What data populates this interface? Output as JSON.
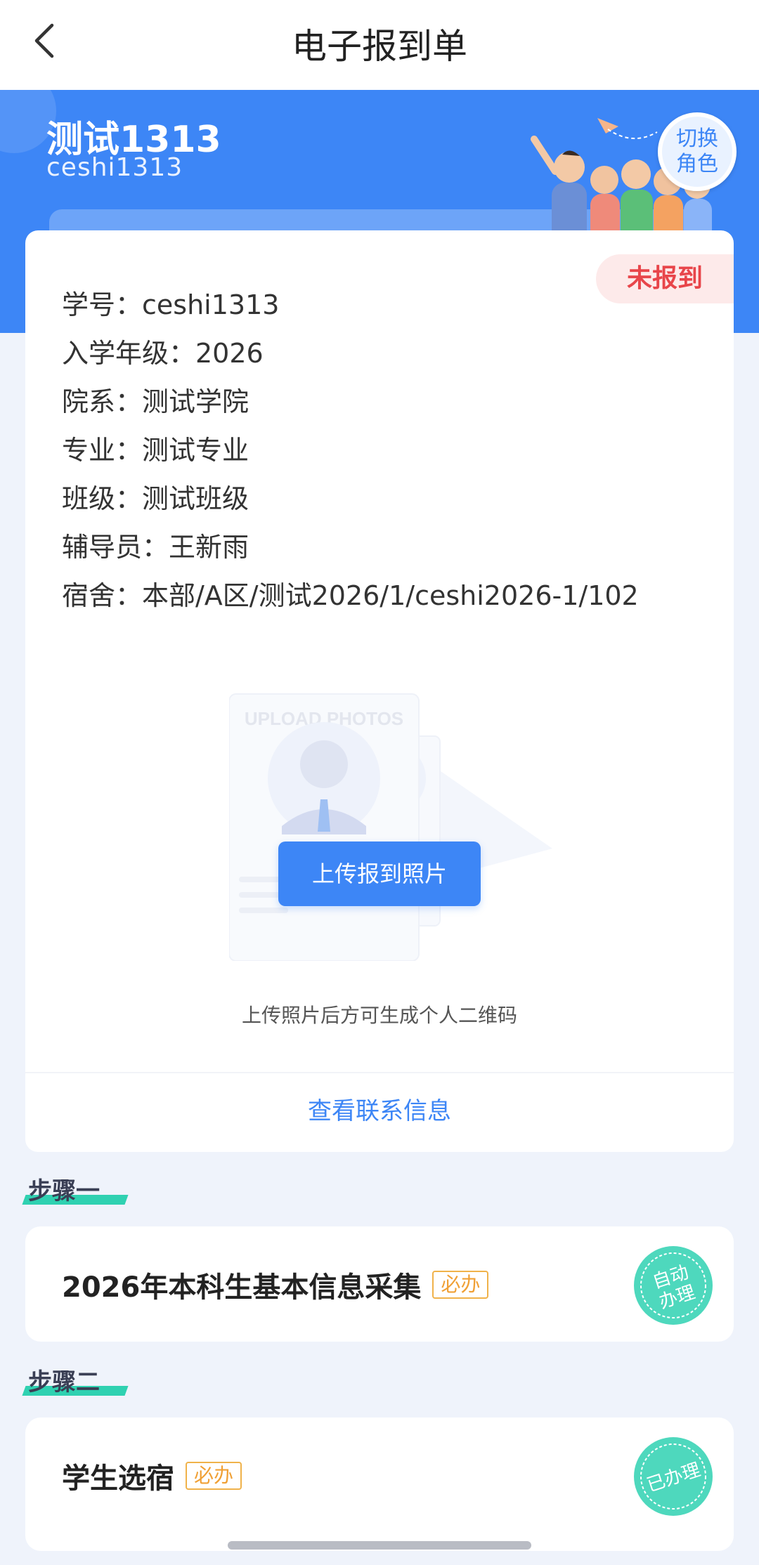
{
  "nav": {
    "title": "电子报到单"
  },
  "hero": {
    "name": "测试1313",
    "account": "ceshi1313",
    "switch_role_line1": "切换",
    "switch_role_line2": "角色"
  },
  "card": {
    "status": "未报到",
    "rows": [
      "学号：ceshi1313",
      "入学年级：2026",
      "院系：测试学院",
      "专业：测试专业",
      "班级：测试班级",
      "辅导员：王新雨",
      "宿舍：本部/A区/测试2026/1/ceshi2026-1/102"
    ],
    "illustration_text": "UPLOAD PHOTOS",
    "upload_button": "上传报到照片",
    "qr_hint": "上传照片后方可生成个人二维码",
    "contact_link": "查看联系信息"
  },
  "steps": [
    {
      "label": "步骤一",
      "title": "2026年本科生基本信息采集",
      "tag": "必办",
      "stamp_line1": "自动",
      "stamp_line2": "办理"
    },
    {
      "label": "步骤二",
      "title": "学生选宿",
      "tag": "必办",
      "stamp_line1": "已办理",
      "stamp_line2": ""
    }
  ],
  "colors": {
    "primary": "#3d86f6",
    "status_red": "#e8454a",
    "stamp_green": "#2fd1b1",
    "tag_orange": "#f0a035"
  }
}
